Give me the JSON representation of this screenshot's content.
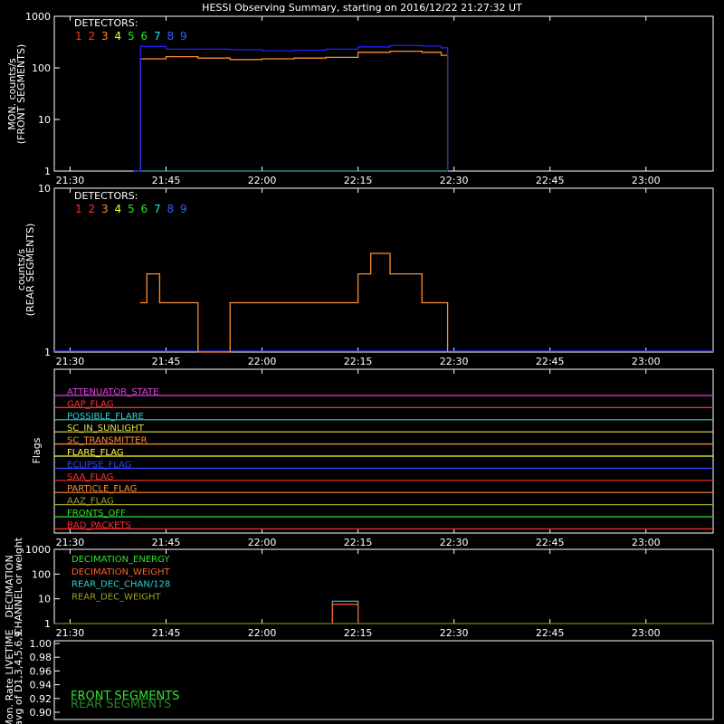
{
  "title": "HESSI Observing Summary, starting on 2016/12/22 21:27:32 UT",
  "colors": {
    "bg": "#000000",
    "axis": "#ffffff",
    "det": [
      "#ff3030",
      "#ff3030",
      "#ff8c30",
      "#ffff40",
      "#30e030",
      "#30e030",
      "#30e0e0",
      "#3060ff",
      "#3060ff"
    ],
    "front_series": "#ff8c30",
    "front_total": "#2020ff",
    "front_low": "#30d0d0",
    "rear_series": "#ff8c30",
    "rear_base": "#2020ff"
  },
  "time_ticks": [
    "21:30",
    "21:45",
    "22:00",
    "22:15",
    "22:30",
    "22:45",
    "23:00"
  ],
  "panel1": {
    "legend_title": "DETECTORS:",
    "legend_digits": [
      "1",
      "2",
      "3",
      "4",
      "5",
      "6",
      "7",
      "8",
      "9"
    ],
    "ylabel_line1": "MON. counts/s",
    "ylabel_line2": "(FRONT SEGMENTS)",
    "yticks": [
      "1000",
      "100",
      "10",
      "1"
    ]
  },
  "panel2": {
    "legend_title": "DETECTORS:",
    "legend_digits": [
      "1",
      "2",
      "3",
      "4",
      "5",
      "6",
      "7",
      "8",
      "9"
    ],
    "ylabel_line1": "counts/s",
    "ylabel_line2": "(REAR SEGMENTS)",
    "yticks": [
      "10",
      "1"
    ]
  },
  "panel3": {
    "ylabel": "Flags",
    "flags": [
      {
        "name": "ATTENUATOR_STATE",
        "color": "#e040e0"
      },
      {
        "name": "GAP_FLAG",
        "color": "#ff3030"
      },
      {
        "name": "POSSIBLE_FLARE",
        "color": "#30d0d0"
      },
      {
        "name": "SC_IN_SUNLIGHT",
        "color": "#e0e040"
      },
      {
        "name": "SC_TRANSMITTER",
        "color": "#ff8c30"
      },
      {
        "name": "FLARE_FLAG",
        "color": "#ffff40"
      },
      {
        "name": "ECLIPSE_FLAG",
        "color": "#3040ff"
      },
      {
        "name": "SAA_FLAG",
        "color": "#ff3030"
      },
      {
        "name": "PARTICLE_FLAG",
        "color": "#ff8c30"
      },
      {
        "name": "AAZ_FLAG",
        "color": "#a0a020"
      },
      {
        "name": "FRONTS_OFF",
        "color": "#30e030"
      },
      {
        "name": "BAD_PACKETS",
        "color": "#ff3030"
      }
    ]
  },
  "panel4": {
    "ylabel_line1": "DECIMATION",
    "ylabel_line2": "CHANNEL or weight",
    "yticks": [
      "1000",
      "100",
      "10",
      "1"
    ],
    "legend": [
      {
        "name": "DECIMATION_ENERGY",
        "color": "#30e030"
      },
      {
        "name": "DECIMATION_WEIGHT",
        "color": "#ff6030"
      },
      {
        "name": "REAR_DEC_CHAN/128",
        "color": "#30d0d0"
      },
      {
        "name": "REAR_DEC_WEIGHT",
        "color": "#a0a020"
      }
    ]
  },
  "panel5": {
    "ylabel_line1": "Mon. Rate LIVETIME",
    "ylabel_line2": "avg of D1,3,4,5,6,9",
    "yticks": [
      "1.00",
      "0.98",
      "0.96",
      "0.94",
      "0.92",
      "0.90"
    ],
    "legend": [
      {
        "name": "FRONT SEGMENTS",
        "color": "#30e030"
      },
      {
        "name": "REAR SEGMENTS",
        "color": "#208a20"
      }
    ]
  },
  "chart_data": [
    {
      "type": "line",
      "xlabel": "",
      "ylabel": "MON. counts/s (FRONT SEGMENTS)",
      "yscale": "log",
      "ylim": [
        1,
        1000
      ],
      "x_range": [
        "21:27:32",
        "23:10:30"
      ],
      "series": [
        {
          "name": "DETECTORS",
          "x": [
            "21:40",
            "21:41",
            "21:45",
            "21:50",
            "21:55",
            "22:00",
            "22:05",
            "22:10",
            "22:15",
            "22:20",
            "22:25",
            "22:28",
            "22:29"
          ],
          "values": [
            1,
            150,
            165,
            155,
            145,
            150,
            155,
            160,
            200,
            210,
            200,
            175,
            1
          ]
        },
        {
          "x": [
            "21:40",
            "21:41",
            "21:45",
            "21:50",
            "21:55",
            "22:00",
            "22:05",
            "22:10",
            "22:15",
            "22:20",
            "22:25",
            "22:28",
            "22:29"
          ],
          "values": [
            1,
            260,
            230,
            230,
            225,
            215,
            220,
            230,
            255,
            270,
            265,
            245,
            1
          ]
        }
      ]
    },
    {
      "type": "line",
      "xlabel": "",
      "ylabel": "counts/s (REAR SEGMENTS)",
      "yscale": "log",
      "ylim": [
        1,
        10
      ],
      "x_range": [
        "21:27:32",
        "23:10:30"
      ],
      "series": [
        {
          "x": [
            "21:41",
            "21:42",
            "21:44",
            "21:46",
            "21:50",
            "21:55",
            "22:00",
            "22:05",
            "22:10",
            "22:15",
            "22:17",
            "22:20",
            "22:25",
            "22:29"
          ],
          "values": [
            2,
            3,
            2,
            2,
            1,
            2,
            2,
            2,
            2,
            3,
            4,
            3,
            2,
            1
          ]
        }
      ]
    },
    {
      "type": "line",
      "ylabel": "DECIMATION CHANNEL or weight",
      "yscale": "log",
      "ylim": [
        1,
        1000
      ],
      "series": [
        {
          "name": "REAR_DEC_CHAN/128",
          "x": [
            "22:11",
            "22:15"
          ],
          "values": [
            8,
            8
          ]
        },
        {
          "name": "DECIMATION_WEIGHT",
          "x": [
            "22:11",
            "22:15"
          ],
          "values": [
            6,
            6
          ]
        }
      ]
    },
    {
      "type": "line",
      "ylabel": "Mon. Rate LIVETIME avg of D1,3,4,5,6,9",
      "ylim": [
        0.9,
        1.0
      ],
      "series": [
        {
          "name": "FRONT SEGMENTS",
          "values": []
        },
        {
          "name": "REAR SEGMENTS",
          "values": []
        }
      ]
    }
  ]
}
